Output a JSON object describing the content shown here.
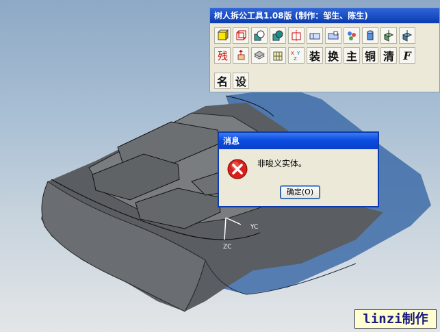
{
  "toolbar": {
    "title": "树人拆公工具1.08版 (制作：邹生、陈生)",
    "row1_icons": [
      "solid-box-icon",
      "wire-cube-icon",
      "sphere-subtract-icon",
      "sphere-unite-icon",
      "split-body-icon",
      "extrude-icon",
      "extrude-alt-icon",
      "group-icon",
      "cylinder-icon",
      "box-point-icon",
      "box-point-alt-icon"
    ],
    "row2_icons": [
      "curve-remove-icon",
      "offset-icon",
      "face-layer-icon",
      "grid-box-icon",
      "xyz-icon"
    ],
    "row2_text": [
      "装",
      "换",
      "主",
      "铜",
      "清",
      "F"
    ],
    "row3_text": [
      "名",
      "设"
    ]
  },
  "dialog": {
    "title": "消息",
    "message": "非唆义实体。",
    "ok_label": "确定(O)",
    "icon": "error-icon"
  },
  "axes": {
    "yc": "YC",
    "zc": "ZC"
  },
  "watermark": "linzi制作"
}
